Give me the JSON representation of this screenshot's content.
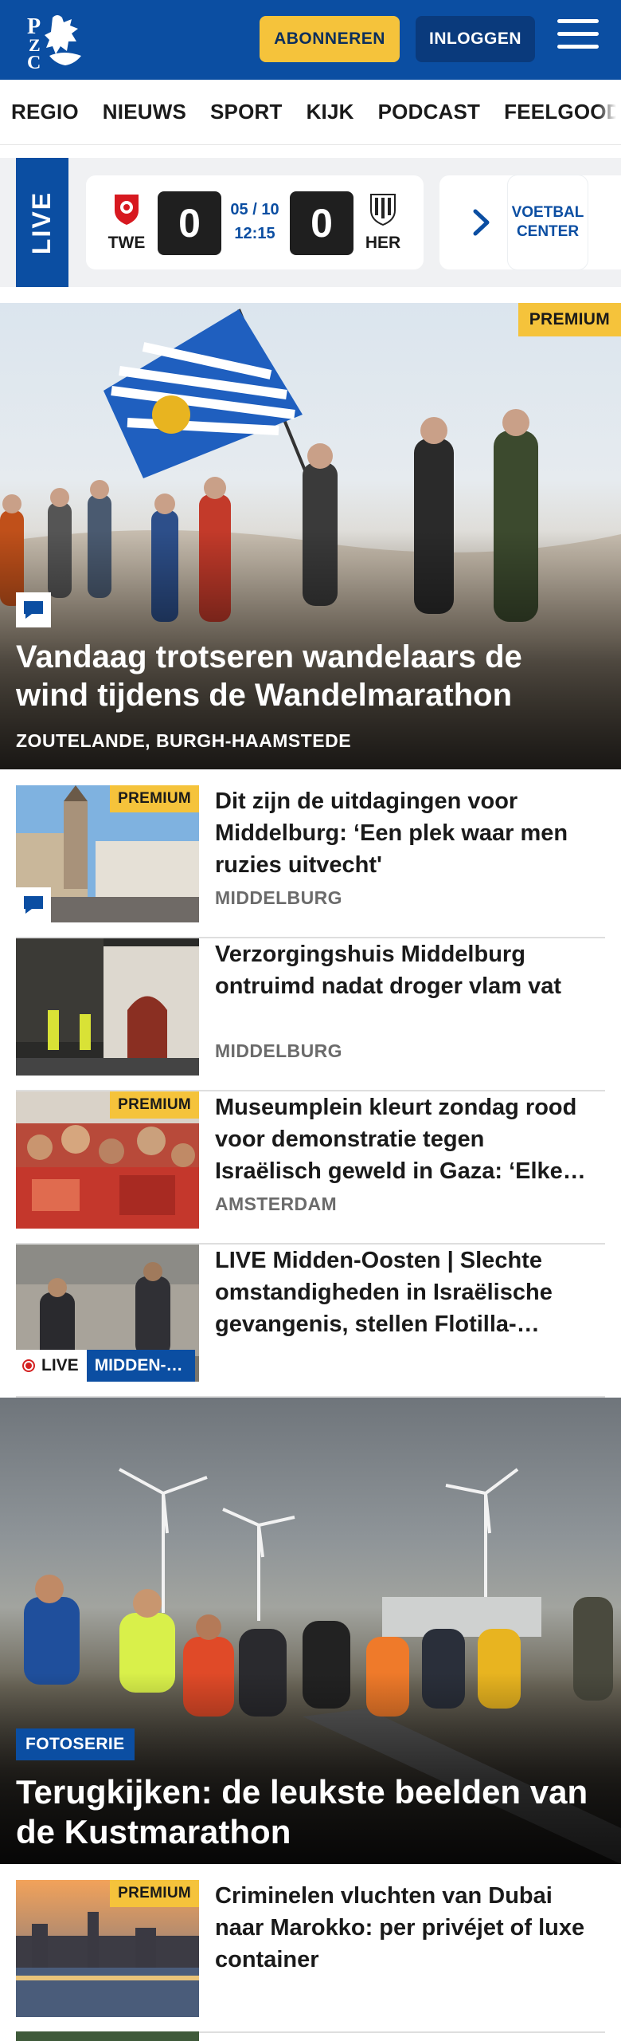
{
  "header": {
    "logo_text": "PZC",
    "subscribe_label": "ABONNEREN",
    "login_label": "INLOGGEN"
  },
  "nav": {
    "items": [
      "REGIO",
      "NIEUWS",
      "SPORT",
      "KIJK",
      "PODCAST",
      "FEELGOOD"
    ]
  },
  "live": {
    "label": "LIVE",
    "match": {
      "home_team": "TWE",
      "home_score": "0",
      "date": "05 / 10",
      "time": "12:15",
      "away_score": "0",
      "away_team": "HER"
    },
    "voetbal_center_label": "VOETBAL CENTER"
  },
  "hero": {
    "badge": "PREMIUM",
    "title": "Vandaag trotseren wandelaars de wind tijdens de Wandelmarathon",
    "location": "ZOUTELANDE, BURGH-HAAMSTEDE"
  },
  "articles": [
    {
      "badge": "PREMIUM",
      "title": "Dit zijn de uitdagingen voor Middelburg: ‘Een plek waar men ruzies uitvecht'",
      "location": "MIDDELBURG"
    },
    {
      "badge": "",
      "title": "Verzorgingshuis Middelburg ontruimd nadat droger vlam vat",
      "location": "MIDDELBURG"
    },
    {
      "badge": "PREMIUM",
      "title": "Museumplein kleurt zondag rood voor demonstratie tegen Israëlisch geweld in Gaza: ‘Elke…",
      "location": "AMSTERDAM"
    },
    {
      "badge": "",
      "title": "LIVE Midden-Oosten | Slechte omstandigheden in Israëlische gevangenis, stellen Flotilla-…",
      "location": "",
      "live_label": "LIVE",
      "live_topic": "MIDDEN-…"
    }
  ],
  "photo_series": {
    "tag": "FOTOSERIE",
    "title": "Terugkijken: de leukste beelden van de Kustmarathon"
  },
  "bottom_article": {
    "badge": "PREMIUM",
    "title": "Criminelen vluchten van Dubai naar Marokko: per privéjet of luxe container"
  },
  "colors": {
    "brand_blue": "#0b4ea2",
    "premium_yellow": "#f5c33b",
    "live_red": "#d42020"
  }
}
